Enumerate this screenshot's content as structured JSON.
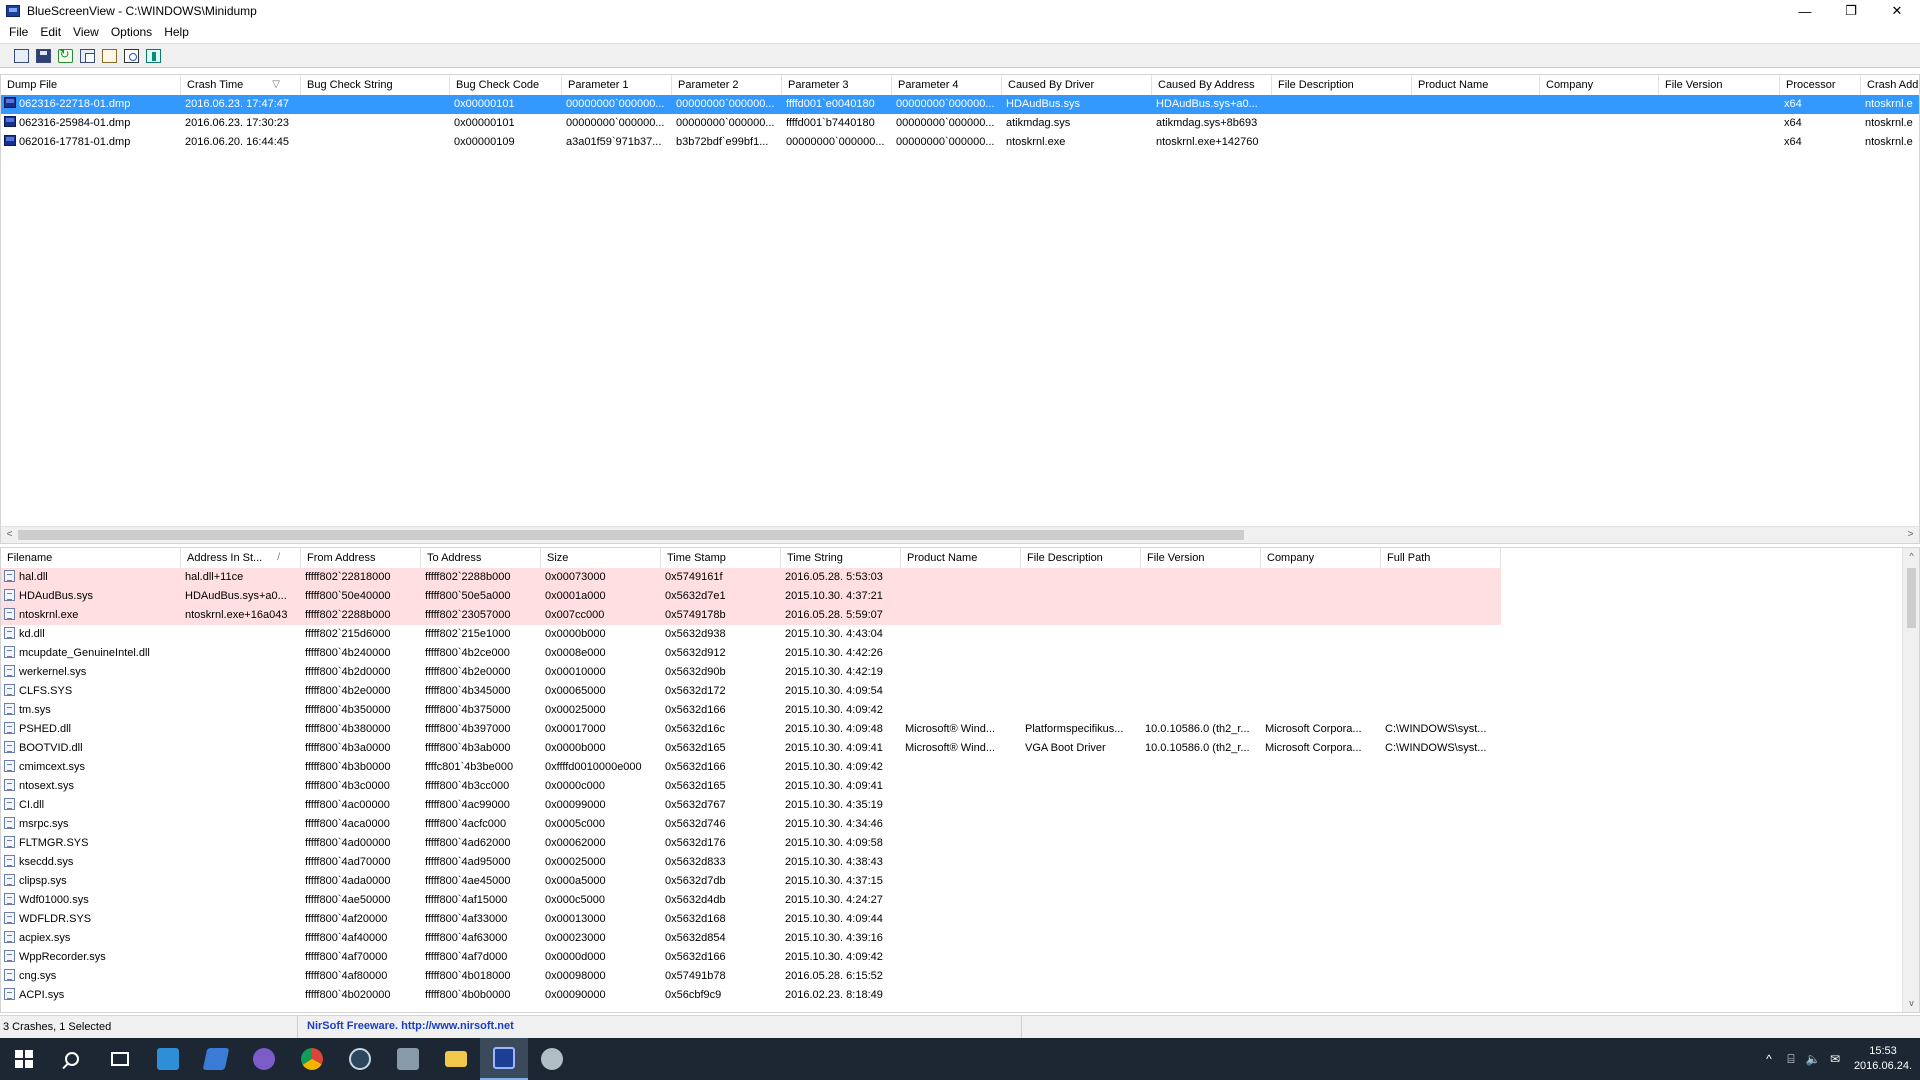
{
  "window": {
    "title": "BlueScreenView  -  C:\\WINDOWS\\Minidump",
    "minimize_glyph": "—",
    "restore_glyph": "❐",
    "close_glyph": "✕"
  },
  "menu": [
    "File",
    "Edit",
    "View",
    "Options",
    "Help"
  ],
  "toolbar_icons": [
    "html-report-icon",
    "save-icon",
    "refresh-icon",
    "copy-icon",
    "properties-icon",
    "find-icon",
    "exit-icon"
  ],
  "upper": {
    "columns": [
      "Dump File",
      "Crash Time",
      "Bug Check String",
      "Bug Check Code",
      "Parameter 1",
      "Parameter 2",
      "Parameter 3",
      "Parameter 4",
      "Caused By Driver",
      "Caused By Address",
      "File Description",
      "Product Name",
      "Company",
      "File Version",
      "Processor",
      "Crash Add"
    ],
    "sort_arrow": "▽",
    "rows": [
      [
        "062316-22718-01.dmp",
        "2016.06.23. 17:47:47",
        "",
        "0x00000101",
        "00000000`000000...",
        "00000000`000000...",
        "ffffd001`e0040180",
        "00000000`000000...",
        "HDAudBus.sys",
        "HDAudBus.sys+a0...",
        "",
        "",
        "",
        "",
        "x64",
        "ntoskrnl.e"
      ],
      [
        "062316-25984-01.dmp",
        "2016.06.23. 17:30:23",
        "",
        "0x00000101",
        "00000000`000000...",
        "00000000`000000...",
        "ffffd001`b7440180",
        "00000000`000000...",
        "atikmdag.sys",
        "atikmdag.sys+8b693",
        "",
        "",
        "",
        "",
        "x64",
        "ntoskrnl.e"
      ],
      [
        "062016-17781-01.dmp",
        "2016.06.20. 16:44:45",
        "",
        "0x00000109",
        "a3a01f59`971b37...",
        "b3b72bdf`e99bf1...",
        "00000000`000000...",
        "00000000`000000...",
        "ntoskrnl.exe",
        "ntoskrnl.exe+142760",
        "",
        "",
        "",
        "",
        "x64",
        "ntoskrnl.e"
      ]
    ],
    "scroll_left": "<",
    "scroll_right": ">"
  },
  "lower": {
    "columns": [
      "Filename",
      "Address In St...",
      "From Address",
      "To Address",
      "Size",
      "Time Stamp",
      "Time String",
      "Product Name",
      "File Description",
      "File Version",
      "Company",
      "Full Path"
    ],
    "sort_arrow": "/",
    "rows": [
      [
        "hal.dll",
        "hal.dll+11ce",
        "fffff802`22818000",
        "fffff802`2288b000",
        "0x00073000",
        "0x5749161f",
        "2016.05.28. 5:53:03",
        "",
        "",
        "",
        "",
        ""
      ],
      [
        "HDAudBus.sys",
        "HDAudBus.sys+a0...",
        "fffff800`50e40000",
        "fffff800`50e5a000",
        "0x0001a000",
        "0x5632d7e1",
        "2015.10.30. 4:37:21",
        "",
        "",
        "",
        "",
        ""
      ],
      [
        "ntoskrnl.exe",
        "ntoskrnl.exe+16a043",
        "fffff802`2288b000",
        "fffff802`23057000",
        "0x007cc000",
        "0x5749178b",
        "2016.05.28. 5:59:07",
        "",
        "",
        "",
        "",
        ""
      ],
      [
        "kd.dll",
        "",
        "fffff802`215d6000",
        "fffff802`215e1000",
        "0x0000b000",
        "0x5632d938",
        "2015.10.30. 4:43:04",
        "",
        "",
        "",
        "",
        ""
      ],
      [
        "mcupdate_GenuineIntel.dll",
        "",
        "fffff800`4b240000",
        "fffff800`4b2ce000",
        "0x0008e000",
        "0x5632d912",
        "2015.10.30. 4:42:26",
        "",
        "",
        "",
        "",
        ""
      ],
      [
        "werkernel.sys",
        "",
        "fffff800`4b2d0000",
        "fffff800`4b2e0000",
        "0x00010000",
        "0x5632d90b",
        "2015.10.30. 4:42:19",
        "",
        "",
        "",
        "",
        ""
      ],
      [
        "CLFS.SYS",
        "",
        "fffff800`4b2e0000",
        "fffff800`4b345000",
        "0x00065000",
        "0x5632d172",
        "2015.10.30. 4:09:54",
        "",
        "",
        "",
        "",
        ""
      ],
      [
        "tm.sys",
        "",
        "fffff800`4b350000",
        "fffff800`4b375000",
        "0x00025000",
        "0x5632d166",
        "2015.10.30. 4:09:42",
        "",
        "",
        "",
        "",
        ""
      ],
      [
        "PSHED.dll",
        "",
        "fffff800`4b380000",
        "fffff800`4b397000",
        "0x00017000",
        "0x5632d16c",
        "2015.10.30. 4:09:48",
        "Microsoft® Wind...",
        "Platformspecifikus...",
        "10.0.10586.0 (th2_r...",
        "Microsoft Corpora...",
        "C:\\WINDOWS\\syst..."
      ],
      [
        "BOOTVID.dll",
        "",
        "fffff800`4b3a0000",
        "fffff800`4b3ab000",
        "0x0000b000",
        "0x5632d165",
        "2015.10.30. 4:09:41",
        "Microsoft® Wind...",
        "VGA Boot Driver",
        "10.0.10586.0 (th2_r...",
        "Microsoft Corpora...",
        "C:\\WINDOWS\\syst..."
      ],
      [
        "cmimcext.sys",
        "",
        "fffff800`4b3b0000",
        "ffffc801`4b3be000",
        "0xffffd0010000e000",
        "0x5632d166",
        "2015.10.30. 4:09:42",
        "",
        "",
        "",
        "",
        ""
      ],
      [
        "ntosext.sys",
        "",
        "fffff800`4b3c0000",
        "fffff800`4b3cc000",
        "0x0000c000",
        "0x5632d165",
        "2015.10.30. 4:09:41",
        "",
        "",
        "",
        "",
        ""
      ],
      [
        "CI.dll",
        "",
        "fffff800`4ac00000",
        "fffff800`4ac99000",
        "0x00099000",
        "0x5632d767",
        "2015.10.30. 4:35:19",
        "",
        "",
        "",
        "",
        ""
      ],
      [
        "msrpc.sys",
        "",
        "fffff800`4aca0000",
        "fffff800`4acfc000",
        "0x0005c000",
        "0x5632d746",
        "2015.10.30. 4:34:46",
        "",
        "",
        "",
        "",
        ""
      ],
      [
        "FLTMGR.SYS",
        "",
        "fffff800`4ad00000",
        "fffff800`4ad62000",
        "0x00062000",
        "0x5632d176",
        "2015.10.30. 4:09:58",
        "",
        "",
        "",
        "",
        ""
      ],
      [
        "ksecdd.sys",
        "",
        "fffff800`4ad70000",
        "fffff800`4ad95000",
        "0x00025000",
        "0x5632d833",
        "2015.10.30. 4:38:43",
        "",
        "",
        "",
        "",
        ""
      ],
      [
        "clipsp.sys",
        "",
        "fffff800`4ada0000",
        "fffff800`4ae45000",
        "0x000a5000",
        "0x5632d7db",
        "2015.10.30. 4:37:15",
        "",
        "",
        "",
        "",
        ""
      ],
      [
        "Wdf01000.sys",
        "",
        "fffff800`4ae50000",
        "fffff800`4af15000",
        "0x000c5000",
        "0x5632d4db",
        "2015.10.30. 4:24:27",
        "",
        "",
        "",
        "",
        ""
      ],
      [
        "WDFLDR.SYS",
        "",
        "fffff800`4af20000",
        "fffff800`4af33000",
        "0x00013000",
        "0x5632d168",
        "2015.10.30. 4:09:44",
        "",
        "",
        "",
        "",
        ""
      ],
      [
        "acpiex.sys",
        "",
        "fffff800`4af40000",
        "fffff800`4af63000",
        "0x00023000",
        "0x5632d854",
        "2015.10.30. 4:39:16",
        "",
        "",
        "",
        "",
        ""
      ],
      [
        "WppRecorder.sys",
        "",
        "fffff800`4af70000",
        "fffff800`4af7d000",
        "0x0000d000",
        "0x5632d166",
        "2015.10.30. 4:09:42",
        "",
        "",
        "",
        "",
        ""
      ],
      [
        "cng.sys",
        "",
        "fffff800`4af80000",
        "fffff800`4b018000",
        "0x00098000",
        "0x57491b78",
        "2016.05.28. 6:15:52",
        "",
        "",
        "",
        "",
        ""
      ],
      [
        "ACPI.sys",
        "",
        "fffff800`4b020000",
        "fffff800`4b0b0000",
        "0x00090000",
        "0x56cbf9c9",
        "2016.02.23. 8:18:49",
        "",
        "",
        "",
        "",
        ""
      ]
    ],
    "scroll_up": "^",
    "scroll_down": "v"
  },
  "status": {
    "count": "3 Crashes, 1 Selected",
    "link": "NirSoft Freeware.  http://www.nirsoft.net"
  },
  "taskbar": {
    "apps": [
      "start-icon",
      "search-icon",
      "task-view-icon",
      "app-icon-1",
      "app-icon-2",
      "app-icon-3",
      "chrome-icon",
      "steam-icon",
      "app-icon-4",
      "file-explorer-icon",
      "bluescreenview-icon",
      "app-icon-5"
    ],
    "tray": [
      "^",
      "⌸",
      "🔈",
      "✉"
    ],
    "time": "15:53",
    "date": "2016.06.24."
  }
}
